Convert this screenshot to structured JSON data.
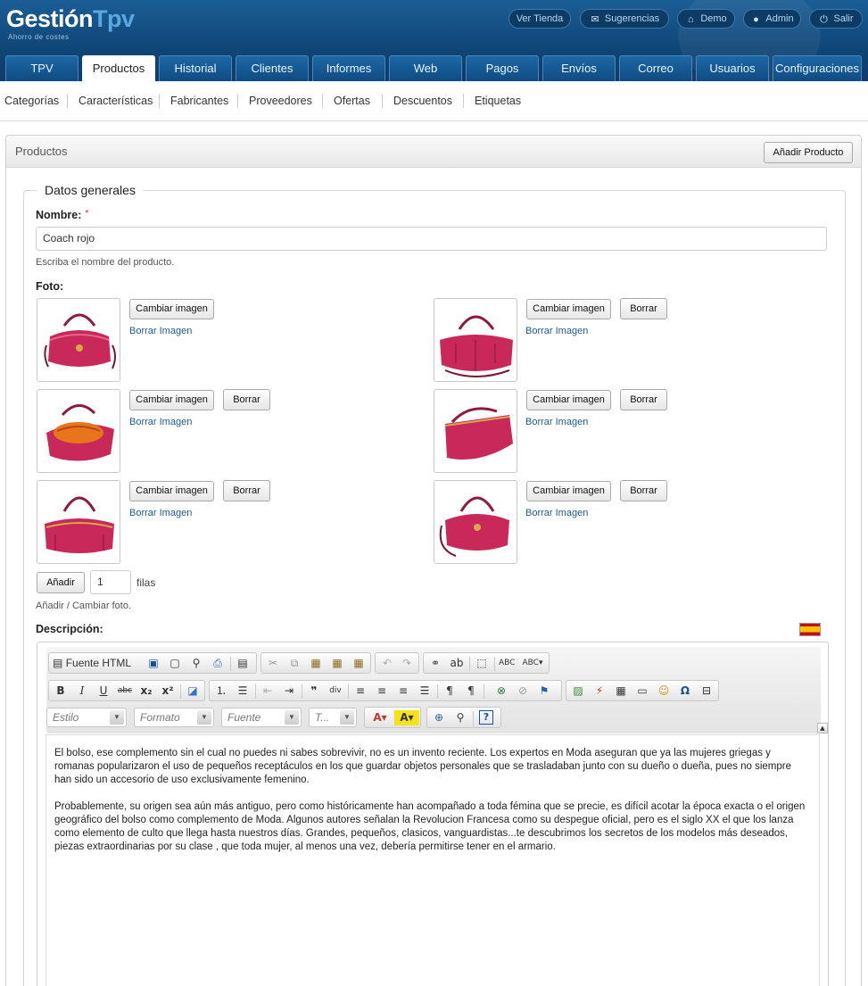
{
  "header": {
    "logo_main": "Gestión",
    "logo_accent": "Tpv",
    "logo_sub": "Ahorro de costes",
    "top_links": [
      {
        "label": "Ver Tienda",
        "icon": ""
      },
      {
        "label": "Sugerencias",
        "icon": "envelope-icon"
      },
      {
        "label": "Demo",
        "icon": "home-icon"
      },
      {
        "label": "Admin",
        "icon": "user-icon"
      },
      {
        "label": "Salir",
        "icon": "power-icon"
      }
    ],
    "tabs": [
      "TPV",
      "Productos",
      "Historial",
      "Clientes",
      "Informes",
      "Web",
      "Pagos",
      "Envíos",
      "Correo",
      "Usuarios",
      "Configuraciones"
    ],
    "active_tab": "Productos"
  },
  "subnav": [
    "Categorías",
    "Características",
    "Fabricantes",
    "Proveedores",
    "Ofertas",
    "Descuentos",
    "Etiquetas"
  ],
  "panel": {
    "title": "Productos",
    "add_button": "Añadir Producto"
  },
  "form": {
    "legend": "Datos generales",
    "name_label": "Nombre:",
    "required_mark": "*",
    "name_value": "Coach rojo",
    "name_hint": "Escriba el nombre del producto.",
    "photo_label": "Foto:",
    "change_image": "Cambiar imagen",
    "delete": "Borrar",
    "delete_image": "Borrar Imagen",
    "add_button": "Añadir",
    "rows_value": "1",
    "rows_label": "filas",
    "photo_hint": "Añadir / Cambiar foto.",
    "description_label": "Descripción:"
  },
  "editor": {
    "source_label": "Fuente HTML",
    "combo_style": "Estilo",
    "combo_format": "Formato",
    "combo_font": "Fuente",
    "combo_size": "T...",
    "paragraph1": "El bolso, ese complemento sin el cual no puedes ni sabes sobrevivir, no es un invento reciente. Los expertos en Moda aseguran que ya las mujeres griegas y romanas popularizaron el uso de pequeños receptáculos en los que guardar objetos personales que se trasladaban junto con su dueño o dueña, pues no siempre han sido un accesorio de uso exclusivamente femenino.",
    "paragraph2": "Probablemente, su origen sea aún más antiguo, pero como históricamente han acompañado a toda fémina que se precie, es difícil acotar la época exacta o el origen geográfico del bolso como complemento de Moda. Algunos autores señalan la Revolucion Francesa como su despegue oficial, pero es el siglo XX el que los lanza como elemento de culto que llega hasta nuestros días. Grandes, pequeños, clasicos, vanguardistas...te descubrimos los secretos de los modelos más deseados, piezas extraordinarias por su clase , que toda mujer, al menos una vez, debería permitirse tener en el armario."
  },
  "colors": {
    "header_blue": "#0f4577",
    "accent_light": "#5aa8e0",
    "link_blue": "#1f5b91",
    "bag_pink": "#c8285a"
  }
}
